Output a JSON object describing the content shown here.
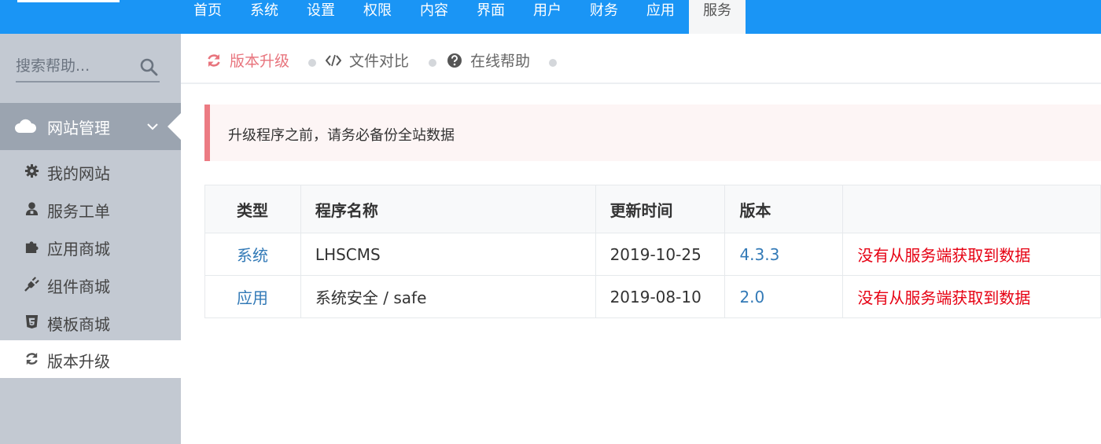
{
  "topnav": {
    "items": [
      {
        "label": "首页"
      },
      {
        "label": "系统"
      },
      {
        "label": "设置"
      },
      {
        "label": "权限"
      },
      {
        "label": "内容"
      },
      {
        "label": "界面"
      },
      {
        "label": "用户"
      },
      {
        "label": "财务"
      },
      {
        "label": "应用"
      },
      {
        "label": "服务",
        "active": true
      }
    ]
  },
  "sidebar": {
    "search": {
      "placeholder": "搜索帮助..."
    },
    "group": {
      "label": "网站管理",
      "icon": "cloud-icon"
    },
    "items": [
      {
        "label": "我的网站",
        "icon": "gear-icon"
      },
      {
        "label": "服务工单",
        "icon": "user-support-icon"
      },
      {
        "label": "应用商城",
        "icon": "puzzle-icon"
      },
      {
        "label": "组件商城",
        "icon": "plug-icon"
      },
      {
        "label": "模板商城",
        "icon": "html5-icon"
      },
      {
        "label": "版本升级",
        "icon": "refresh-icon",
        "active": true
      }
    ]
  },
  "tabs": [
    {
      "label": "版本升级",
      "icon": "refresh-icon",
      "active": true
    },
    {
      "label": "文件对比",
      "icon": "code-icon"
    },
    {
      "label": "在线帮助",
      "icon": "question-circle-icon"
    }
  ],
  "alert": {
    "text": "升级程序之前，请务必备份全站数据"
  },
  "table": {
    "headers": [
      "类型",
      "程序名称",
      "更新时间",
      "版本",
      ""
    ],
    "rows": [
      {
        "type": "系统",
        "name": "LHSCMS",
        "updated": "2019-10-25",
        "version": "4.3.3",
        "status": "没有从服务端获取到数据"
      },
      {
        "type": "应用",
        "name": "系统安全 / safe",
        "updated": "2019-08-10",
        "version": "2.0",
        "status": "没有从服务端获取到数据"
      }
    ]
  },
  "colors": {
    "topbar": "#1a95f5",
    "sidebar": "#c3c9d2",
    "active_tab": "#e8747d",
    "link": "#337ab7",
    "error": "#e60012"
  }
}
